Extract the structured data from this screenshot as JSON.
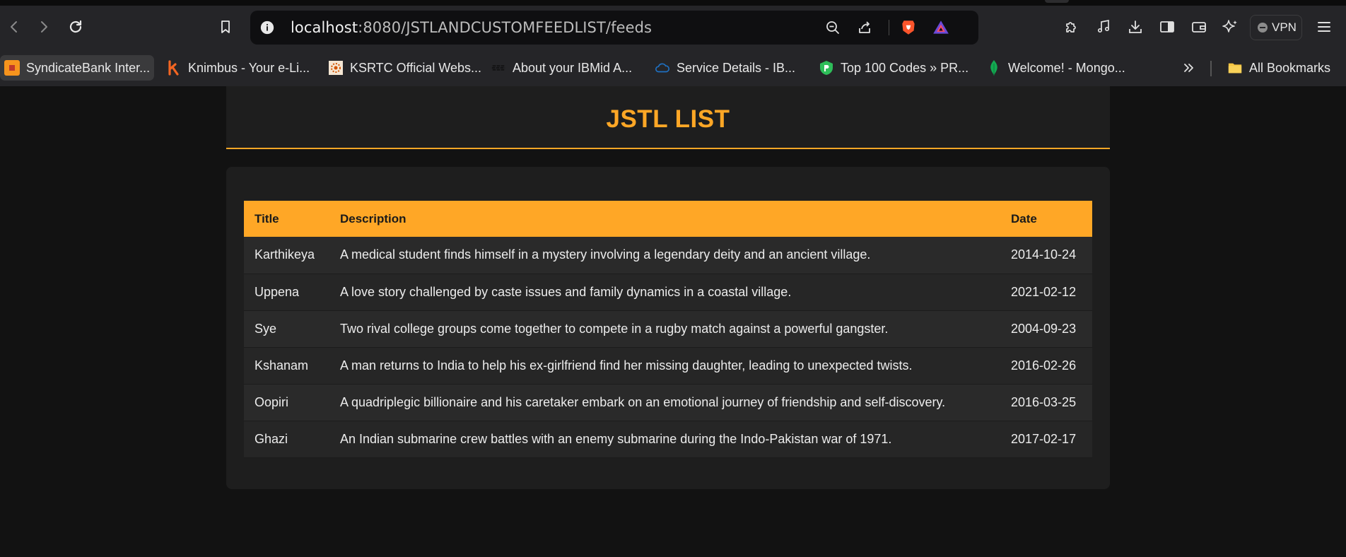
{
  "browser": {
    "url_host": "localhost",
    "url_path": ":8080/JSTLANDCUSTOMFEEDLIST/feeds",
    "vpn_label": "VPN",
    "bookmarks": [
      {
        "label": "SyndicateBank Inter...",
        "icon": "syndicatebank-icon"
      },
      {
        "label": "Knimbus - Your e-Li...",
        "icon": "knimbus-icon"
      },
      {
        "label": "KSRTC Official Webs...",
        "icon": "ksrtc-icon"
      },
      {
        "label": "About your IBMid A...",
        "icon": "ibm-icon"
      },
      {
        "label": "Service Details - IB...",
        "icon": "ibm-cloud-icon"
      },
      {
        "label": "Top 100 Codes » PR...",
        "icon": "shield-icon"
      },
      {
        "label": "Welcome! - Mongo...",
        "icon": "mongodb-leaf-icon"
      }
    ],
    "all_bookmarks_label": "All Bookmarks"
  },
  "page": {
    "title": "JSTL LIST",
    "table": {
      "headers": [
        "Title",
        "Description",
        "Date"
      ],
      "rows": [
        {
          "title": "Karthikeya",
          "description": "A medical student finds himself in a mystery involving a legendary deity and an ancient village.",
          "date": "2014-10-24"
        },
        {
          "title": "Uppena",
          "description": "A love story challenged by caste issues and family dynamics in a coastal village.",
          "date": "2021-02-12"
        },
        {
          "title": "Sye",
          "description": "Two rival college groups come together to compete in a rugby match against a powerful gangster.",
          "date": "2004-09-23"
        },
        {
          "title": "Kshanam",
          "description": "A man returns to India to help his ex-girlfriend find her missing daughter, leading to unexpected twists.",
          "date": "2016-02-26"
        },
        {
          "title": "Oopiri",
          "description": "A quadriplegic billionaire and his caretaker embark on an emotional journey of friendship and self-discovery.",
          "date": "2016-03-25"
        },
        {
          "title": "Ghazi",
          "description": "An Indian submarine crew battles with an enemy submarine during the Indo-Pakistan war of 1971.",
          "date": "2017-02-17"
        }
      ]
    }
  },
  "colors": {
    "accent": "#ffa726",
    "page_bg": "#121212",
    "card_bg": "#1e1e1e"
  }
}
